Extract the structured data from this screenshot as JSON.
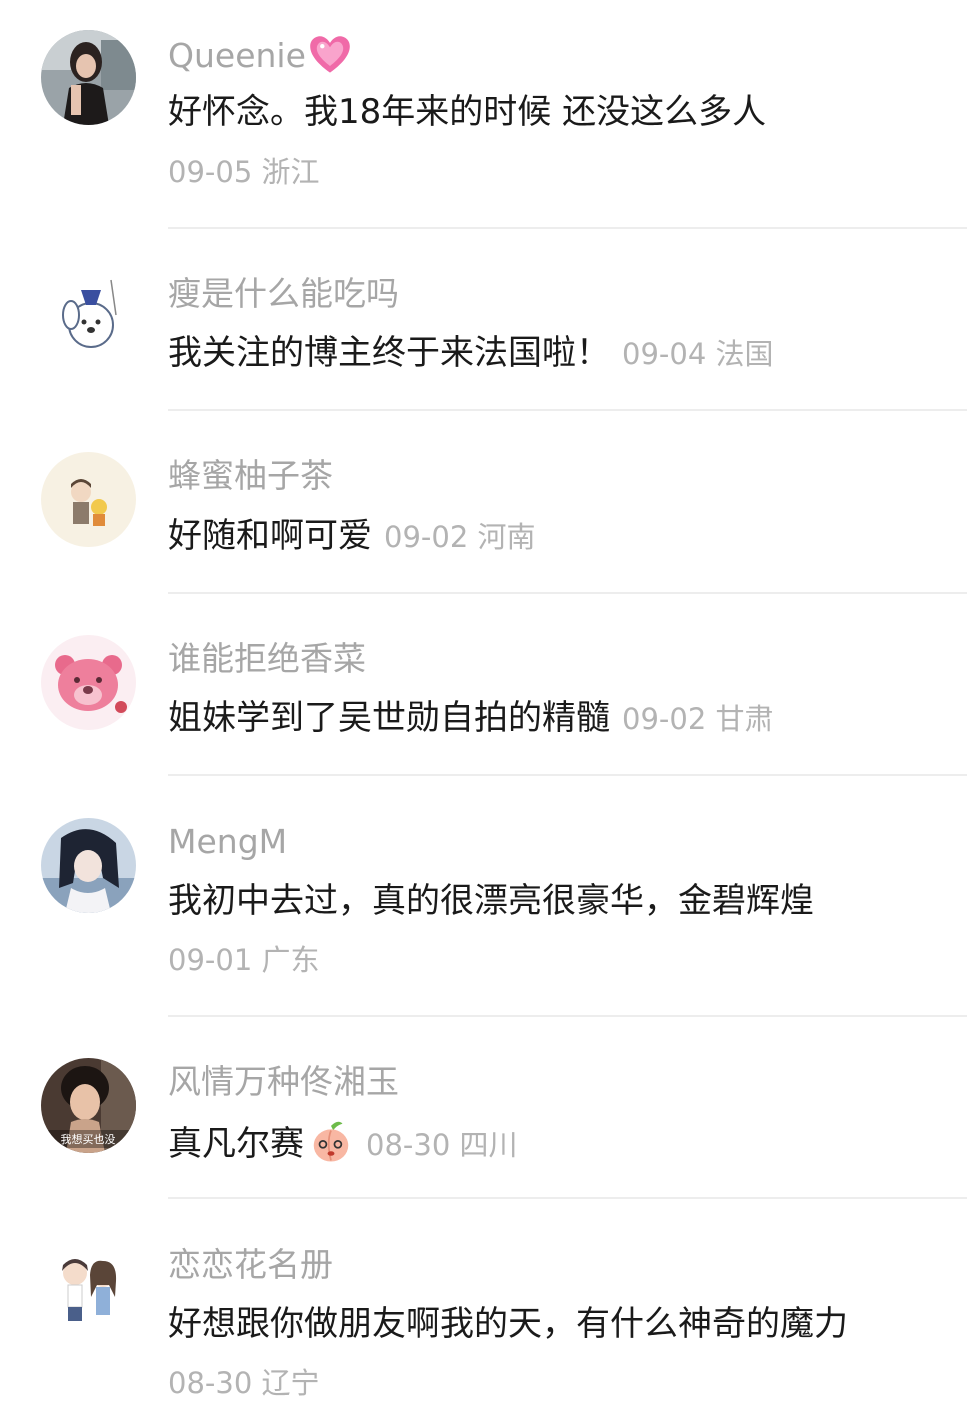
{
  "comments": [
    {
      "username": "Queenie",
      "text": "好怀念。我18年来的时候 还没这么多人",
      "date": "09-05",
      "location": "浙江",
      "avatar": "woman-photo-avatar",
      "username_emoji": "sparkling-heart"
    },
    {
      "username": "瘦是什么能吃吗",
      "text": "我关注的博主终于来法国啦！",
      "date": "09-04",
      "location": "法国",
      "avatar": "cartoon-dog-avatar"
    },
    {
      "username": "蜂蜜柚子茶",
      "text": "好随和啊可爱",
      "date": "09-02",
      "location": "河南",
      "avatar": "cartoon-boy-avatar"
    },
    {
      "username": "谁能拒绝香菜",
      "text": "姐妹学到了吴世勋自拍的精髓",
      "date": "09-02",
      "location": "甘肃",
      "avatar": "pink-bear-avatar"
    },
    {
      "username": "MengM",
      "text": "我初中去过，真的很漂亮很豪华，金碧辉煌",
      "date": "09-01",
      "location": "广东",
      "avatar": "anime-girl-avatar"
    },
    {
      "username": "风情万种佟湘玉",
      "text": "真凡尔赛",
      "date": "08-30",
      "location": "四川",
      "avatar": "actress-meme-avatar",
      "text_emoji": "peach-face",
      "avatar_caption": "我想买也没"
    },
    {
      "username": "恋恋花名册",
      "text": "好想跟你做朋友啊我的天，有什么神奇的魔力",
      "date": "08-30",
      "location": "辽宁",
      "avatar": "cartoon-couple-avatar"
    }
  ]
}
